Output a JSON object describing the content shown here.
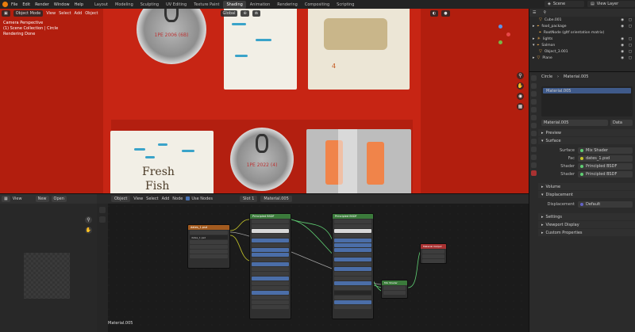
{
  "menu": [
    "File",
    "Edit",
    "Render",
    "Window",
    "Help"
  ],
  "workspaces": [
    "Layout",
    "Modeling",
    "Sculpting",
    "UV Editing",
    "Texture Paint",
    "Shading",
    "Animation",
    "Rendering",
    "Compositing",
    "Scripting"
  ],
  "active_workspace": "Shading",
  "top_right": {
    "scene": "Scene",
    "view_layer": "View Layer",
    "options": "Options"
  },
  "viewport": {
    "mode": "Object Mode",
    "menus": [
      "View",
      "Select",
      "Add",
      "Object"
    ],
    "orientation": "Global",
    "info": [
      "Camera Perspective",
      "(1) Scene Collection | Circle",
      "Rendering Done"
    ],
    "can_text_top": "1PE 2006 (6B)",
    "can_text_bottom": "1PE 2022 (4)",
    "pack_brand_1": "Fresh",
    "pack_brand_2": "Fish",
    "pack_number": "4"
  },
  "image_editor": {
    "view": "View",
    "new": "New",
    "open": "Open"
  },
  "node_editor": {
    "object": "Object",
    "menus": [
      "View",
      "Select",
      "Add",
      "Node"
    ],
    "use_nodes": "Use Nodes",
    "slot": "Slot 1",
    "material": "Material.005",
    "footer": "Material.005",
    "nodes": {
      "image": "dates_1.psd",
      "bsdf_a": "Principled BSDF",
      "bsdf_b": "Principled BSDF",
      "mix": "Mix Shader",
      "output": "Material Output"
    }
  },
  "outliner": [
    {
      "label": "Cube.001",
      "indent": 1
    },
    {
      "label": "food_package",
      "indent": 0
    },
    {
      "label": "RootNode (gltf orientation matrix)",
      "indent": 1
    },
    {
      "label": "lights",
      "indent": 0
    },
    {
      "label": "Salmon",
      "indent": 0
    },
    {
      "label": "Object_3.001",
      "indent": 1
    },
    {
      "label": "Plane",
      "indent": 0
    }
  ],
  "properties": {
    "object": "Circle",
    "material": "Material.005",
    "slot": "Material.005",
    "material_field": "Material.005",
    "data_mode": "Data",
    "panels": {
      "preview": "Preview",
      "surface": "Surface",
      "volume": "Volume",
      "displacement": "Displacement",
      "settings": "Settings",
      "viewport_display": "Viewport Display",
      "custom_properties": "Custom Properties"
    },
    "surface": {
      "surface_label": "Surface",
      "surface_value": "Mix Shader",
      "fac_label": "Fac",
      "fac_value": "dates_1.psd",
      "shader1_label": "Shader",
      "shader1_value": "Principled BSDF",
      "shader2_label": "Shader",
      "shader2_value": "Principled BSDF"
    },
    "displacement_row": {
      "label": "Displacement",
      "value": "Default"
    }
  },
  "colors": {
    "accent": "#e87d0d",
    "selection": "#334d80",
    "viewport_bg": "#b21e0e"
  }
}
